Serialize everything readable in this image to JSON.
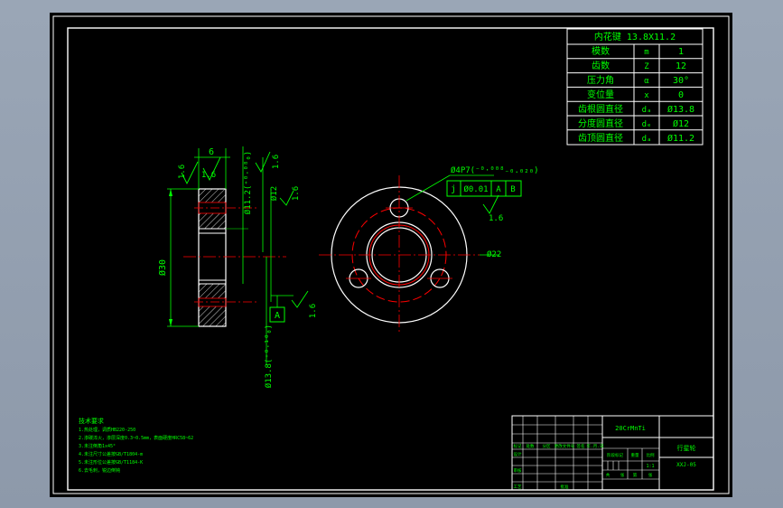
{
  "colors": {
    "chrome_bg": "#9aa6b6",
    "canvas_bg": "#000000",
    "geometry": "#ffffff",
    "dimension": "#00ff00",
    "centerline": "#ff0000",
    "hatch": "#ffffff"
  },
  "spec_table": {
    "title": "内花键 13.8X11.2",
    "rows": [
      {
        "label": "模数",
        "symbol": "m",
        "value": "1"
      },
      {
        "label": "齿数",
        "symbol": "Z",
        "value": "12"
      },
      {
        "label": "压力角",
        "symbol": "α",
        "value": "30°"
      },
      {
        "label": "变位量",
        "symbol": "x",
        "value": "0"
      },
      {
        "label": "齿根圆直径",
        "symbol": "dₐ",
        "value": "Ø13.8"
      },
      {
        "label": "分度圆直径",
        "symbol": "dₑ",
        "value": "Ø12"
      },
      {
        "label": "齿顶圆直径",
        "symbol": "dₐ",
        "value": "Ø11.2"
      }
    ]
  },
  "side_view": {
    "roughness_top_left": "1.6",
    "roughness_top_mid": "1.6",
    "width_dim": "6",
    "dia_outer": "Ø30",
    "dia_tip": "Ø11.2(⁺⁰·⁰⁸₀)",
    "dia_pitch": "Ø12",
    "dia_root": "Ø13.8(⁺⁰·¹⁰₀)",
    "roughness_right_top": "1.6",
    "roughness_right_mid": "1.6",
    "roughness_right_bottom": "1.6",
    "datum": "A"
  },
  "front_view": {
    "hole_callout": "Ø4P7(⁻⁰·⁰⁰⁸₋₀.₀₂₀)",
    "fcf_symbol": "j",
    "fcf_tol": "Ø0.01",
    "fcf_datum1": "A",
    "fcf_datum2": "B",
    "roughness": "1.6",
    "dia_outer": "Ø22"
  },
  "notes": {
    "heading": "技术要求",
    "items": [
      "1.热处理，调质HB220-250",
      "2.渗碳淬火，渗层深度0.3~0.5mm，表面硬度HRC58~62",
      "3.未注倒角1x45°",
      "4.未注尺寸公差按GB/T1804-m",
      "5.未注形位公差按GB/T1184-K",
      "6.去毛刺，锐边倒钝"
    ]
  },
  "title_block": {
    "part_title": "20CrMnTi",
    "weight_row": [
      "标记",
      "处数",
      "分区",
      "更改文件号",
      "签名",
      "年.月.日"
    ],
    "stage_label": "阶段标记",
    "mass_label": "重量",
    "scale_label": "比例",
    "scale_value": "1:1",
    "design_label": "设计",
    "audit_label": "审核",
    "process_label": "工艺",
    "approve_label": "批准",
    "sheet_row": [
      "共",
      "张",
      "第",
      "张"
    ],
    "part_name": "行星轮",
    "drawing_no": "XXJ-05"
  }
}
